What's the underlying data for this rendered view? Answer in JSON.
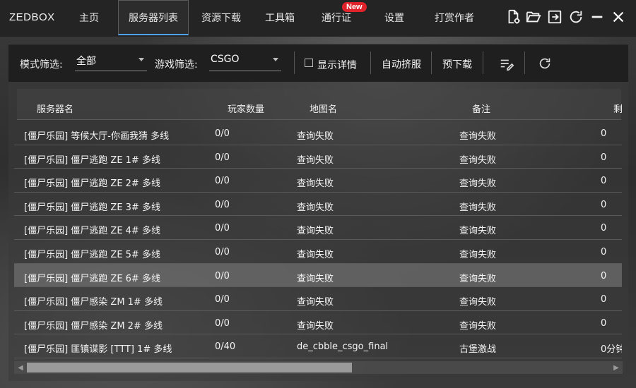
{
  "app": {
    "title": "ZEDBOX"
  },
  "nav": {
    "tabs": [
      {
        "label": "主页"
      },
      {
        "label": "服务器列表",
        "active": true
      },
      {
        "label": "资源下载"
      },
      {
        "label": "工具箱"
      },
      {
        "label": "通行证",
        "badge": "New"
      },
      {
        "label": "设置"
      },
      {
        "label": "打赏作者"
      }
    ]
  },
  "window_icons": [
    "file-settings-icon",
    "folder-open-icon",
    "login-icon",
    "refresh-icon",
    "minimize-icon",
    "close-icon"
  ],
  "filters": {
    "mode_label": "模式筛选:",
    "mode_value": "全部",
    "game_label": "游戏筛选:",
    "game_value": "CSGO",
    "show_details_label": "显示详情",
    "show_details_checked": false,
    "auto_squeeze_label": "自动挤服",
    "pre_download_label": "预下载",
    "icons": [
      "edit-list-icon",
      "refresh-icon"
    ]
  },
  "table": {
    "headers": [
      "服务器名",
      "玩家数量",
      "地图名",
      "备注",
      "剩"
    ],
    "rows": [
      {
        "name": "[僵尸乐园] 等候大厅-你画我猜 多线",
        "players": "0/0",
        "map": "查询失败",
        "note": "查询失败",
        "remain": "0"
      },
      {
        "name": "[僵尸乐园] 僵尸逃跑 ZE 1# 多线",
        "players": "0/0",
        "map": "查询失败",
        "note": "查询失败",
        "remain": "0"
      },
      {
        "name": "[僵尸乐园] 僵尸逃跑 ZE 2# 多线",
        "players": "0/0",
        "map": "查询失败",
        "note": "查询失败",
        "remain": "0"
      },
      {
        "name": "[僵尸乐园] 僵尸逃跑 ZE 3# 多线",
        "players": "0/0",
        "map": "查询失败",
        "note": "查询失败",
        "remain": "0"
      },
      {
        "name": "[僵尸乐园] 僵尸逃跑 ZE 4# 多线",
        "players": "0/0",
        "map": "查询失败",
        "note": "查询失败",
        "remain": "0"
      },
      {
        "name": "[僵尸乐园] 僵尸逃跑 ZE 5# 多线",
        "players": "0/0",
        "map": "查询失败",
        "note": "查询失败",
        "remain": "0"
      },
      {
        "name": "[僵尸乐园] 僵尸逃跑 ZE 6# 多线",
        "players": "0/0",
        "map": "查询失败",
        "note": "查询失败",
        "remain": "0",
        "selected": true
      },
      {
        "name": "[僵尸乐园] 僵尸感染 ZM 1# 多线",
        "players": "0/0",
        "map": "查询失败",
        "note": "查询失败",
        "remain": "0"
      },
      {
        "name": "[僵尸乐园] 僵尸感染 ZM 2# 多线",
        "players": "0/0",
        "map": "查询失败",
        "note": "查询失败",
        "remain": "0"
      },
      {
        "name": "[僵尸乐园] 匪镇谍影 [TTT] 1# 多线",
        "players": "0/40",
        "map": "de_cbble_csgo_final",
        "note": "古堡激战",
        "remain": "0分钟"
      }
    ]
  },
  "colors": {
    "accent": "#4da3ff",
    "badge": "#e0232a",
    "topbar": "#242424",
    "filterbar": "#1f1f1f",
    "selected_row": "#6e6e6e"
  }
}
